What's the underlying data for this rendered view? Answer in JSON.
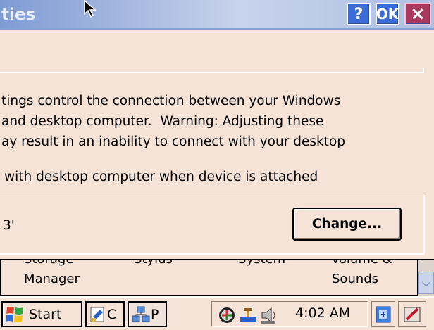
{
  "window": {
    "title_fragment": "ties",
    "help_label": "?",
    "ok_label": "OK",
    "close_label": "×"
  },
  "dialog": {
    "description_lines": [
      "tings control the connection between your Windows",
      "and desktop computer.  Warning: Adjusting these",
      "ay result in an inability to connect with your desktop"
    ],
    "sync_option": "with desktop computer when device is attached",
    "connection_value": "3'",
    "change_label": "Change..."
  },
  "control_panel": {
    "items": [
      {
        "top": "Storage",
        "label": "Manager"
      },
      {
        "top": "Stylus",
        "label": ""
      },
      {
        "top": "System",
        "label": ""
      },
      {
        "top": "Volume &",
        "label": "Sounds"
      }
    ]
  },
  "taskbar": {
    "start_label": "Start",
    "task_c": "C",
    "task_p": "P",
    "clock": "4:02 AM"
  }
}
